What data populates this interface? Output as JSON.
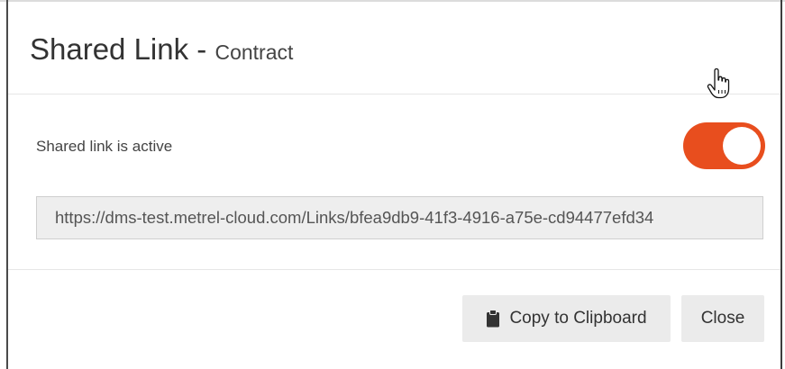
{
  "dialog": {
    "title": "Shared Link -",
    "subtitle": "Contract"
  },
  "shared_link": {
    "active_label": "Shared link is active",
    "toggle_on": true,
    "toggle_color": "#e84e1e",
    "url": "https://dms-test.metrel-cloud.com/Links/bfea9db9-41f3-4916-a75e-cd94477efd34"
  },
  "footer": {
    "copy_label": "Copy to Clipboard",
    "copy_icon": "clipboard-icon",
    "close_label": "Close"
  },
  "cursor": {
    "icon": "hand-pointer-icon"
  }
}
